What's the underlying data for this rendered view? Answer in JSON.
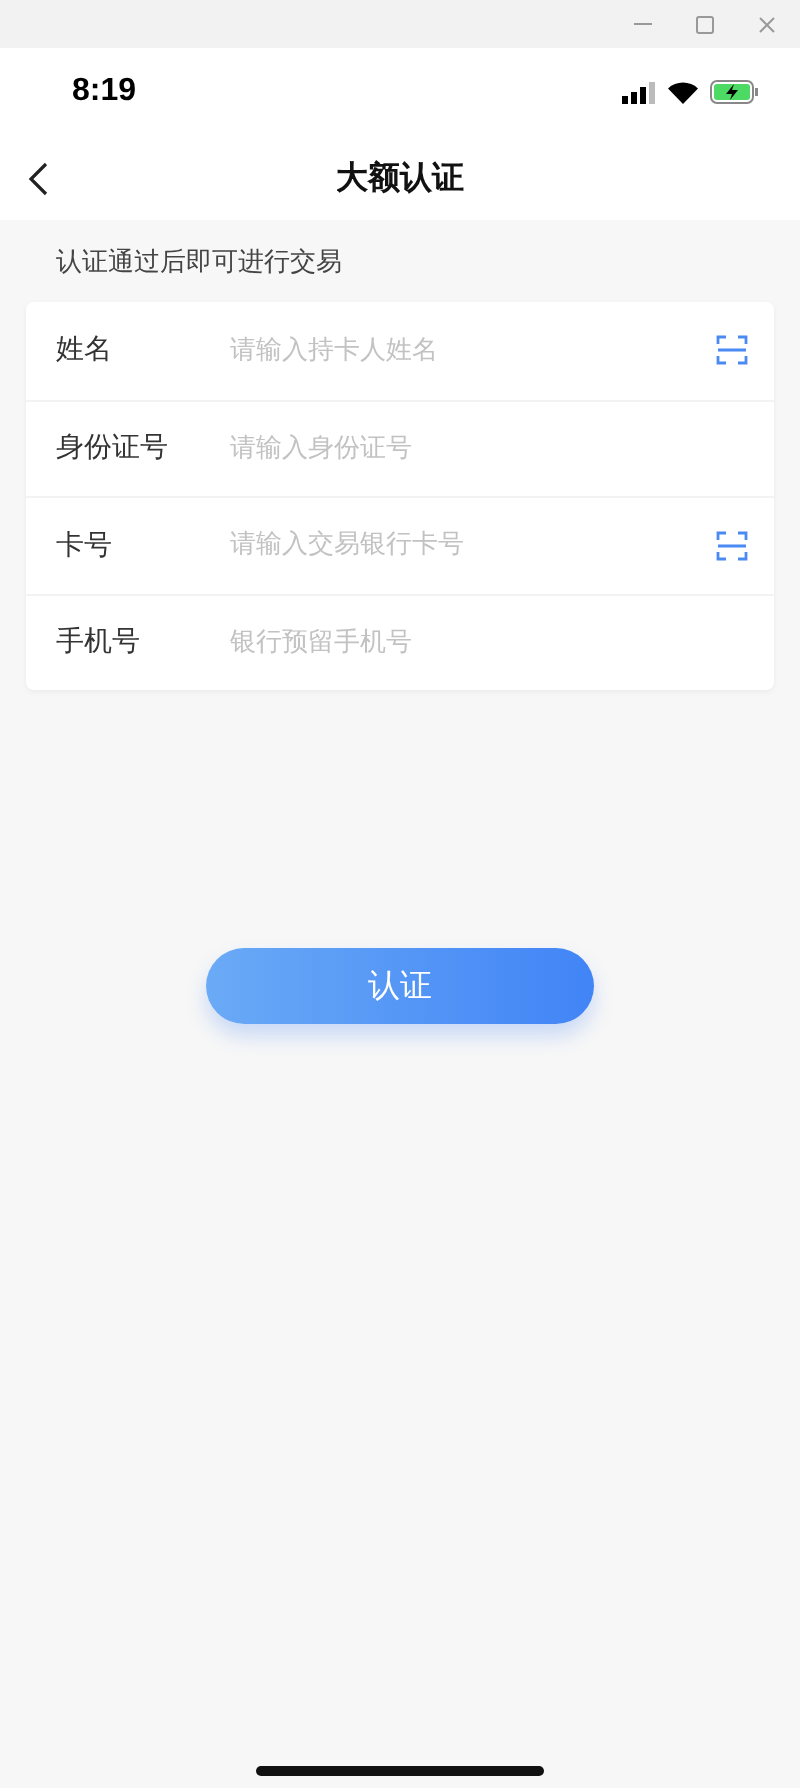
{
  "status_bar": {
    "time": "8:19"
  },
  "nav": {
    "title": "大额认证"
  },
  "hint": "认证通过后即可进行交易",
  "fields": [
    {
      "label": "姓名",
      "placeholder": "请输入持卡人姓名",
      "scan": true
    },
    {
      "label": "身份证号",
      "placeholder": "请输入身份证号",
      "scan": false
    },
    {
      "label": "卡号",
      "placeholder": "请输入交易银行卡号",
      "scan": true
    },
    {
      "label": "手机号",
      "placeholder": "银行预留手机号",
      "scan": false
    }
  ],
  "submit": "认证"
}
